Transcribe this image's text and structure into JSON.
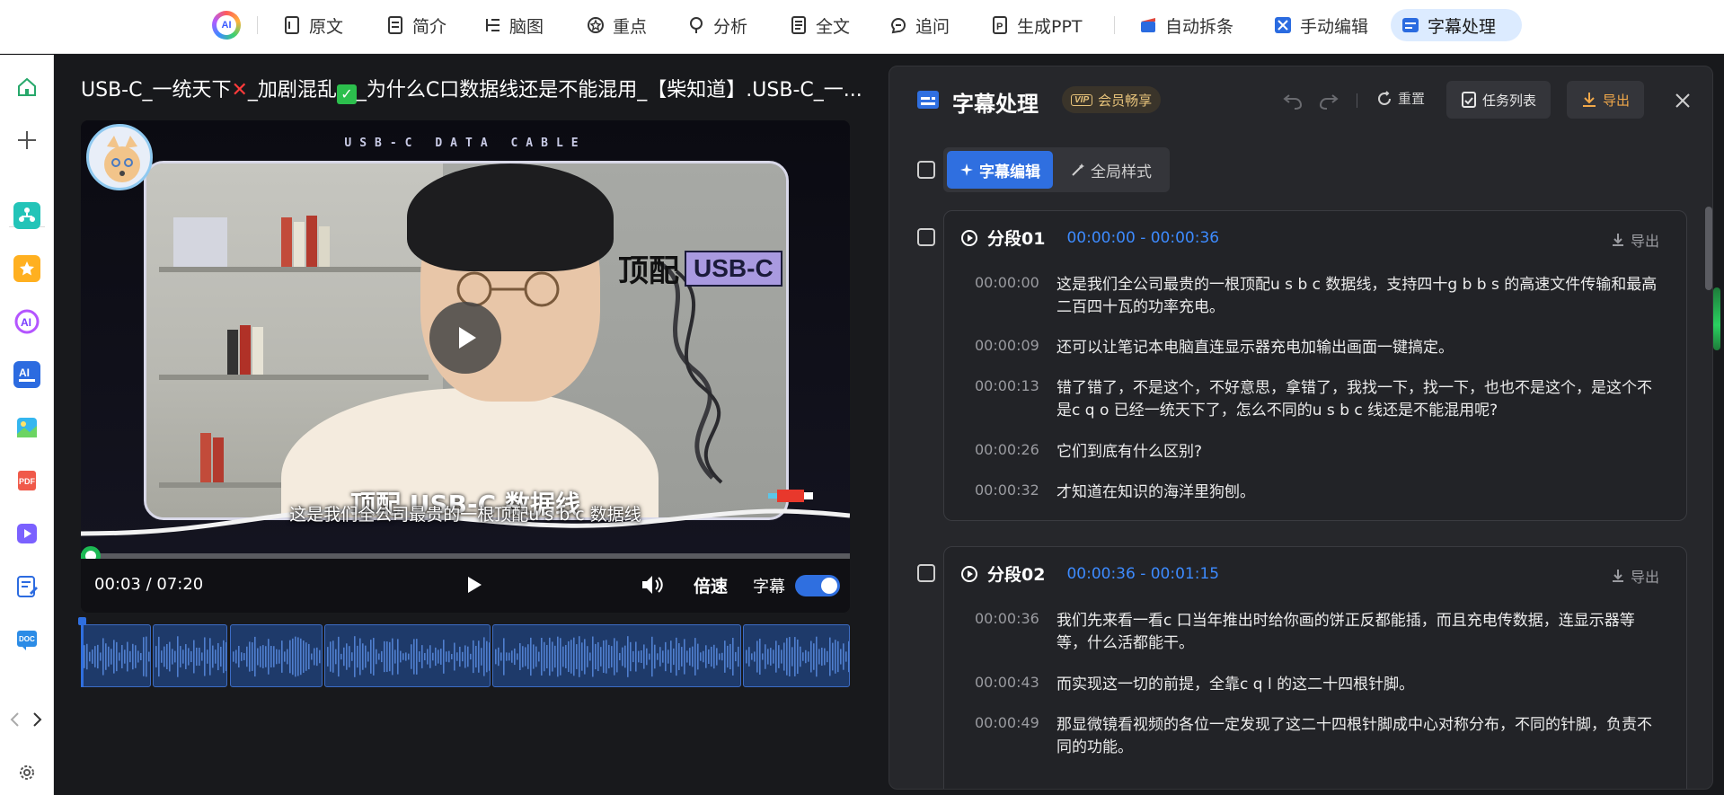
{
  "toolbar": {
    "logo_text": "AI",
    "items": [
      {
        "label": "原文"
      },
      {
        "label": "简介"
      },
      {
        "label": "脑图"
      },
      {
        "label": "重点"
      },
      {
        "label": "分析"
      },
      {
        "label": "全文"
      },
      {
        "label": "追问"
      },
      {
        "label": "生成PPT"
      },
      {
        "label": "自动拆条"
      },
      {
        "label": "手动编辑"
      },
      {
        "label": "字幕处理"
      }
    ]
  },
  "video": {
    "title_part1": "USB-C_一统天下",
    "title_part2": "_加剧混乱",
    "title_part3": "_为什么C口数据线还是不能混用_【柴知道】.USB-C_一...",
    "banner": "USB-C DATA CABLE",
    "overlay_tag_left": "顶配",
    "overlay_tag_right": "USB-C",
    "caption_big": "顶配 USB-C 数据线",
    "caption_small": "这是我们全公司最贵的一根顶配u s b c 数据线",
    "current_time": "00:03 / 07:20",
    "progress_fraction": 0.009,
    "speed_label": "倍速",
    "subtitle_label": "字幕",
    "subtitle_toggle_on": true
  },
  "panel": {
    "title": "字幕处理",
    "vip_badge": "VIP",
    "vip_label": "会员畅享",
    "reset_label": "重置",
    "tasks_label": "任务列表",
    "export_label": "导出",
    "tabs": [
      {
        "label": "字幕编辑",
        "active": true
      },
      {
        "label": "全局样式",
        "active": false
      }
    ],
    "segments": [
      {
        "name": "分段01",
        "range": "00:00:00 - 00:00:36",
        "export_label": "导出",
        "lines": [
          {
            "time": "00:00:00",
            "text": "这是我们全公司最贵的一根顶配u s b c 数据线，支持四十g b b s 的高速文件传输和最高二百四十瓦的功率充电。"
          },
          {
            "time": "00:00:09",
            "text": "还可以让笔记本电脑直连显示器充电加输出画面一键搞定。"
          },
          {
            "time": "00:00:13",
            "text": "错了错了，不是这个，不好意思，拿错了，我找一下，找一下，也也不是这个，是这个不是c q o 已经一统天下了，怎么不同的u s b c 线还是不能混用呢?"
          },
          {
            "time": "00:00:26",
            "text": "它们到底有什么区别?"
          },
          {
            "time": "00:00:32",
            "text": "才知道在知识的海洋里狗刨。"
          }
        ]
      },
      {
        "name": "分段02",
        "range": "00:00:36 - 00:01:15",
        "export_label": "导出",
        "lines": [
          {
            "time": "00:00:36",
            "text": "我们先来看一看c 口当年推出时给你画的饼正反都能插，而且充电传数据，连显示器等等，什么活都能干。"
          },
          {
            "time": "00:00:43",
            "text": "而实现这一切的前提，全靠c q l 的这二十四根针脚。"
          },
          {
            "time": "00:00:49",
            "text": "那显微镜看视频的各位一定发现了这二十四根针脚成中心对称分布，不同的针脚，负责不同的功能。"
          }
        ]
      }
    ]
  },
  "colors": {
    "accent": "#2f6fe0",
    "time_range": "#3d8bff",
    "export_orange": "#f0a84a",
    "panel_bg": "#26272b",
    "vip_gold": "#e6c27a"
  }
}
